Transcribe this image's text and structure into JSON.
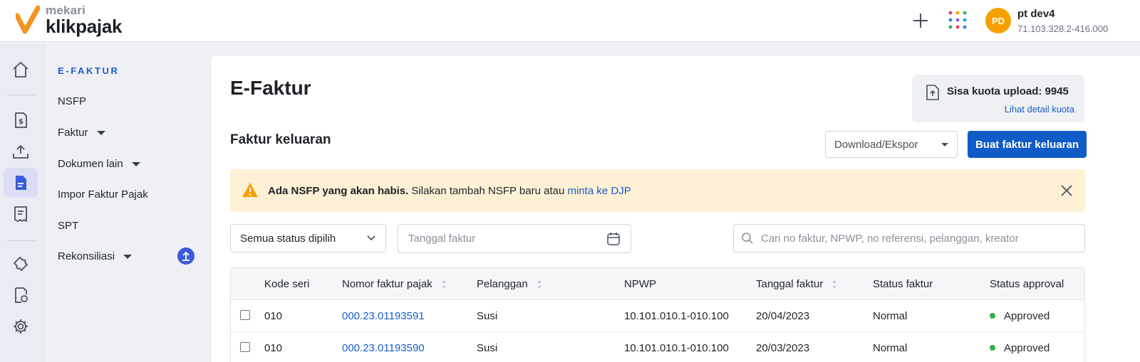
{
  "header": {
    "brand": "mekari",
    "product": "klikpajak",
    "user": {
      "initials": "PD",
      "name": "pt dev4",
      "npwp": "71.103.328.2-416.000"
    }
  },
  "rail": {
    "icons": [
      "home-icon",
      "invoice-dollar-icon",
      "upload-tray-icon",
      "efaktur-document-icon",
      "receipt-icon",
      "puzzle-icon",
      "report-settings-icon",
      "gear-icon"
    ],
    "active": "efaktur-document-icon"
  },
  "subnav": {
    "title": "E-FAKTUR",
    "items": [
      {
        "label": "NSFP",
        "has_caret": false
      },
      {
        "label": "Faktur",
        "has_caret": true
      },
      {
        "label": "Dokumen lain",
        "has_caret": true
      },
      {
        "label": "Impor Faktur Pajak",
        "has_caret": false
      },
      {
        "label": "SPT",
        "has_caret": false
      },
      {
        "label": "Rekonsiliasi",
        "has_caret": true
      }
    ]
  },
  "main": {
    "title": "E-Faktur",
    "quota": {
      "label": "Sisa kuota upload: 9945",
      "link": "Lihat detail kuota"
    },
    "section_title": "Faktur keluaran",
    "download_select": "Download/Ekspor",
    "create_button": "Buat faktur keluaran",
    "alert": {
      "bold": "Ada NSFP yang akan habis.",
      "text": "Silakan tambah NSFP baru atau",
      "link": "minta ke DJP",
      "color": "#fdf0d5"
    },
    "filters": {
      "status": "Semua status dipilih",
      "date_placeholder": "Tanggal faktur",
      "search_placeholder": "Cari no faktur, NPWP, no referensi, pelanggan, kreator"
    },
    "table": {
      "columns": [
        "Kode seri",
        "Nomor faktur pajak",
        "Pelanggan",
        "NPWP",
        "Tanggal faktur",
        "Status faktur",
        "Status approval"
      ],
      "rows": [
        {
          "kode": "010",
          "nomor": "000.23.01193591",
          "pelanggan": "Susi",
          "npwp": "10.101.010.1-010.100",
          "tanggal": "20/04/2023",
          "status": "Normal",
          "approval": "Approved"
        },
        {
          "kode": "010",
          "nomor": "000.23.01193590",
          "pelanggan": "Susi",
          "npwp": "10.101.010.1-010.100",
          "tanggal": "20/03/2023",
          "status": "Normal",
          "approval": "Approved"
        }
      ]
    }
  },
  "colors": {
    "accent": "#0f5bc7",
    "link": "#1a5dc7",
    "approved": "#2fb344",
    "avatar": "#f5a000",
    "brand_check": "#f5931e"
  }
}
